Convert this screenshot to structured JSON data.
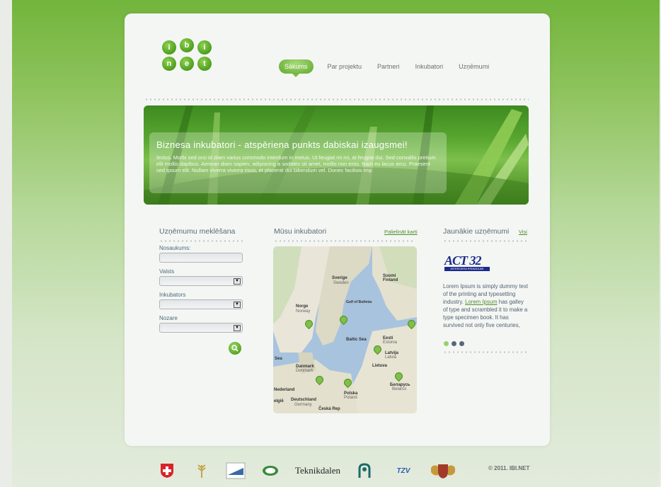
{
  "logo": {
    "letters": [
      "i",
      "b",
      "i",
      "n",
      "e",
      "t"
    ]
  },
  "nav": {
    "items": [
      {
        "label": "Sākums",
        "active": true
      },
      {
        "label": "Par projektu"
      },
      {
        "label": "Partneri"
      },
      {
        "label": "Inkubatori"
      },
      {
        "label": "Uzņēmumi"
      }
    ]
  },
  "hero": {
    "headline": "Biznesa inkubatori - atspēriena punkts dabiskai izaugsmei!",
    "text": "lectus. Morbi sed orci id diam varius commodo interdum in metus. Ut feugiat mi mi, at feugiat dui. Sed convallis pretium elit mollis dapibus. Aenean diam sapien, adipiscing a sodales sit amet, mollis non eros. Nam eu lacus arcu. Praesent sed ipsum elit. Nullam viverra viverra risus, et placerat dui bibendum vel. Donec facilisis imp"
  },
  "search": {
    "title": "Uzņēmumu meklēšana",
    "fields": {
      "name_label": "Nosaukums:",
      "country_label": "Valsts",
      "incubator_label": "Inkubators",
      "sector_label": "Nozare"
    }
  },
  "incubators": {
    "title": "Mūsu inkubatori",
    "map_link": "Palielināt karti",
    "map_labels": {
      "sverige": "Sverige",
      "sweden": "Sweden",
      "suomi": "Suomi",
      "finland": "Finland",
      "norge": "Norge",
      "norway": "Norway",
      "gulf": "Gulf of Bothnia",
      "baltic": "Baltic Sea",
      "eesti": "Eesti",
      "estonia": "Estonia",
      "latvija": "Latvija",
      "latvia": "Latvia",
      "lietuva": "Lietuva",
      "danmark": "Danmark",
      "denmark": "Denmark",
      "sea": "Sea",
      "nederland": "Nederland",
      "polska": "Polska",
      "poland": "Poland",
      "deutschland": "Deutschland",
      "germany": "Germany",
      "cesko": "Česká Rep",
      "belarus": "Беларусь",
      "belarus_en": "Belarus",
      "belgie": "elgië"
    }
  },
  "latest": {
    "title": "Jaunākie uzņēmumi",
    "all_link": "Visi",
    "company_brand": "ACT 32",
    "company_sub": "INTERIJERA RISINĀJUMI",
    "text_before": "Lorem Ipsum is simply dummy text of the printing and typesetting industry. ",
    "text_link": "Lorem Ipsum",
    "text_after": " has galley of type and scrambled it to make a type specimen book. It has survived not only five centuries,"
  },
  "footer": {
    "partners": [
      "Teknikdalen",
      "TZV"
    ],
    "copyright": "© 2011. IBI.NET"
  },
  "colors": {
    "accent_green": "#6fb33a",
    "link_green": "#4d8e2a",
    "text_slate": "#5a6a78"
  }
}
